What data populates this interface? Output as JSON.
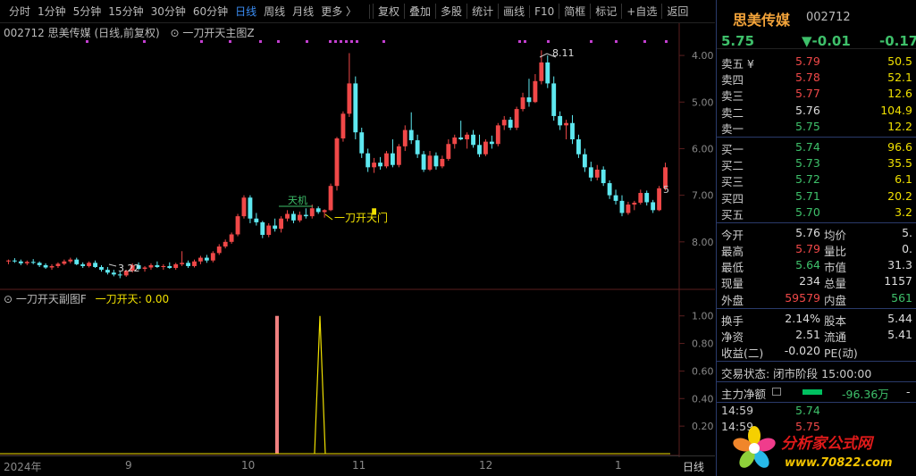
{
  "toolbar": {
    "periods": [
      "分时",
      "1分钟",
      "5分钟",
      "15分钟",
      "30分钟",
      "60分钟",
      "日线",
      "周线",
      "月线",
      "更多 〉"
    ],
    "active_period": "日线",
    "actions": [
      "复权",
      "叠加",
      "多股",
      "统计",
      "画线",
      "F10",
      "简框",
      "标记",
      "+自选",
      "返回"
    ]
  },
  "main_title": {
    "code": "002712",
    "name": "思美传媒",
    "mode": "(日线,前复权)",
    "indicator": "一刀开天主图Z"
  },
  "sub_title": {
    "name": "一刀开天副图F",
    "value_label": "一刀开天: 0.00"
  },
  "annotations": {
    "high": "8.11",
    "low": "3.22",
    "tianji": "天机",
    "signal": "一刀开天门",
    "last": "5"
  },
  "price_axis": [
    "8.00",
    "7.00",
    "6.00",
    "5.00",
    "4.00"
  ],
  "sub_axis": [
    "1.00",
    "0.80",
    "0.60",
    "0.40",
    "0.20"
  ],
  "date_axis": [
    "2024年",
    "9",
    "10",
    "11",
    "12",
    "1"
  ],
  "period_tag": "日线",
  "stock": {
    "name": "思美传媒",
    "code": "002712",
    "price": "5.75",
    "change": "▼-0.01",
    "pct": "-0.17"
  },
  "asks": [
    {
      "label": "卖五 ¥",
      "price": "5.79",
      "vol": "50.5"
    },
    {
      "label": "卖四",
      "price": "5.78",
      "vol": "52.1"
    },
    {
      "label": "卖三",
      "price": "5.77",
      "vol": "12.6"
    },
    {
      "label": "卖二",
      "price": "5.76",
      "vol": "104.9"
    },
    {
      "label": "卖一",
      "price": "5.75",
      "vol": "12.2"
    }
  ],
  "bids": [
    {
      "label": "买一",
      "price": "5.74",
      "vol": "96.6"
    },
    {
      "label": "买二",
      "price": "5.73",
      "vol": "35.5"
    },
    {
      "label": "买三",
      "price": "5.72",
      "vol": "6.1"
    },
    {
      "label": "买四",
      "price": "5.71",
      "vol": "20.2"
    },
    {
      "label": "买五",
      "price": "5.70",
      "vol": "3.2"
    }
  ],
  "stats": [
    {
      "l1": "今开",
      "v1": "5.76",
      "l2": "均价",
      "v2": "5."
    },
    {
      "l1": "最高",
      "v1": "5.79",
      "l2": "量比",
      "v2": "0."
    },
    {
      "l1": "最低",
      "v1": "5.64",
      "l2": "市值",
      "v2": "31.3"
    },
    {
      "l1": "现量",
      "v1": "234",
      "l2": "总量",
      "v2": "1157"
    },
    {
      "l1": "外盘",
      "v1": "59579",
      "l2": "内盘",
      "v2": "561"
    }
  ],
  "stats2": [
    {
      "l1": "换手",
      "v1": "2.14%",
      "l2": "股本",
      "v2": "5.44"
    },
    {
      "l1": "净资",
      "v1": "2.51",
      "l2": "流通",
      "v2": "5.41"
    },
    {
      "l1": "收益(二)",
      "v1": "-0.020",
      "l2": "PE(动)",
      "v2": ""
    }
  ],
  "trade_status": "交易状态: 闭市阶段 15:00:00",
  "main_flow": {
    "label": "主力净额",
    "value": "-96.36万",
    "tail": "-"
  },
  "ticks": [
    {
      "time": "14:59",
      "price": "5.74"
    },
    {
      "time": "14:59",
      "price": "5.75"
    }
  ],
  "logo_text": "分析家公式网",
  "logo_url": "www.70822.com",
  "colors": {
    "up": "#f04848",
    "down": "#5ee8f0",
    "signal": "#f0e000",
    "pink": "#f08080"
  },
  "chart_data": {
    "type": "candlestick",
    "ylim": [
      3.0,
      8.5
    ],
    "ticks": [
      4,
      5,
      6,
      7,
      8
    ],
    "high_label": 8.11,
    "low_label": 3.22,
    "candles": [
      [
        3.58,
        3.62,
        3.52,
        3.6
      ],
      [
        3.6,
        3.65,
        3.55,
        3.58
      ],
      [
        3.58,
        3.62,
        3.5,
        3.54
      ],
      [
        3.54,
        3.6,
        3.5,
        3.57
      ],
      [
        3.57,
        3.63,
        3.52,
        3.55
      ],
      [
        3.55,
        3.58,
        3.46,
        3.5
      ],
      [
        3.5,
        3.54,
        3.42,
        3.45
      ],
      [
        3.45,
        3.52,
        3.4,
        3.48
      ],
      [
        3.48,
        3.56,
        3.44,
        3.53
      ],
      [
        3.53,
        3.62,
        3.5,
        3.58
      ],
      [
        3.58,
        3.66,
        3.54,
        3.62
      ],
      [
        3.62,
        3.66,
        3.5,
        3.52
      ],
      [
        3.52,
        3.56,
        3.44,
        3.48
      ],
      [
        3.48,
        3.58,
        3.45,
        3.55
      ],
      [
        3.55,
        3.6,
        3.44,
        3.46
      ],
      [
        3.46,
        3.5,
        3.36,
        3.4
      ],
      [
        3.4,
        3.46,
        3.3,
        3.34
      ],
      [
        3.34,
        3.4,
        3.26,
        3.3
      ],
      [
        3.3,
        3.36,
        3.22,
        3.28
      ],
      [
        3.28,
        3.4,
        3.25,
        3.38
      ],
      [
        3.38,
        3.54,
        3.34,
        3.5
      ],
      [
        3.5,
        3.56,
        3.4,
        3.42
      ],
      [
        3.42,
        3.48,
        3.36,
        3.45
      ],
      [
        3.45,
        3.54,
        3.4,
        3.5
      ],
      [
        3.5,
        3.58,
        3.44,
        3.46
      ],
      [
        3.46,
        3.52,
        3.4,
        3.48
      ],
      [
        3.48,
        3.56,
        3.42,
        3.44
      ],
      [
        3.44,
        3.55,
        3.4,
        3.52
      ],
      [
        3.52,
        3.8,
        3.48,
        3.55
      ],
      [
        3.55,
        3.6,
        3.44,
        3.48
      ],
      [
        3.48,
        3.62,
        3.45,
        3.58
      ],
      [
        3.58,
        3.7,
        3.52,
        3.66
      ],
      [
        3.66,
        3.72,
        3.55,
        3.6
      ],
      [
        3.6,
        3.8,
        3.56,
        3.76
      ],
      [
        3.76,
        3.95,
        3.72,
        3.9
      ],
      [
        3.9,
        4.05,
        3.86,
        4.0
      ],
      [
        4.0,
        4.2,
        3.96,
        4.16
      ],
      [
        4.16,
        4.6,
        4.12,
        4.55
      ],
      [
        4.55,
        5.0,
        4.5,
        4.95
      ],
      [
        4.95,
        5.0,
        4.4,
        4.5
      ],
      [
        4.5,
        4.62,
        4.35,
        4.42
      ],
      [
        4.42,
        4.45,
        4.08,
        4.15
      ],
      [
        4.15,
        4.4,
        4.1,
        4.35
      ],
      [
        4.35,
        4.5,
        4.22,
        4.28
      ],
      [
        4.28,
        4.55,
        4.2,
        4.5
      ],
      [
        4.5,
        4.68,
        4.44,
        4.6
      ],
      [
        4.6,
        4.66,
        4.4,
        4.46
      ],
      [
        4.46,
        4.65,
        4.42,
        4.58
      ],
      [
        4.58,
        4.72,
        4.5,
        4.55
      ],
      [
        4.55,
        4.8,
        4.5,
        4.72
      ],
      [
        4.72,
        4.76,
        4.6,
        4.64
      ],
      [
        4.64,
        4.7,
        4.52,
        4.68
      ],
      [
        4.68,
        5.25,
        4.66,
        5.2
      ],
      [
        5.2,
        6.25,
        5.1,
        6.22
      ],
      [
        6.22,
        6.8,
        6.15,
        6.75
      ],
      [
        6.75,
        8.05,
        6.68,
        7.4
      ],
      [
        7.4,
        7.55,
        6.2,
        6.35
      ],
      [
        6.35,
        6.45,
        5.8,
        5.9
      ],
      [
        5.9,
        6.0,
        5.5,
        5.6
      ],
      [
        5.6,
        5.8,
        5.48,
        5.7
      ],
      [
        5.7,
        5.82,
        5.55,
        5.62
      ],
      [
        5.62,
        5.95,
        5.58,
        5.9
      ],
      [
        5.9,
        6.2,
        5.6,
        5.65
      ],
      [
        5.65,
        6.1,
        5.6,
        6.05
      ],
      [
        6.05,
        6.5,
        5.95,
        6.4
      ],
      [
        6.4,
        6.78,
        6.1,
        6.18
      ],
      [
        6.18,
        6.3,
        5.8,
        5.88
      ],
      [
        5.88,
        5.95,
        5.5,
        5.55
      ],
      [
        5.55,
        5.95,
        5.52,
        5.85
      ],
      [
        5.85,
        5.92,
        5.55,
        5.62
      ],
      [
        5.62,
        5.85,
        5.58,
        5.78
      ],
      [
        5.78,
        6.2,
        5.74,
        6.1
      ],
      [
        6.1,
        6.3,
        6.0,
        6.24
      ],
      [
        6.24,
        6.6,
        6.18,
        6.2
      ],
      [
        6.2,
        6.35,
        6.0,
        6.3
      ],
      [
        6.3,
        6.4,
        6.02,
        6.08
      ],
      [
        6.08,
        6.3,
        5.82,
        5.88
      ],
      [
        5.88,
        6.2,
        5.84,
        6.15
      ],
      [
        6.15,
        6.28,
        6.0,
        6.1
      ],
      [
        6.1,
        6.55,
        6.05,
        6.5
      ],
      [
        6.5,
        6.7,
        6.4,
        6.62
      ],
      [
        6.62,
        6.68,
        6.4,
        6.45
      ],
      [
        6.45,
        6.9,
        6.4,
        6.85
      ],
      [
        6.85,
        7.2,
        6.8,
        7.1
      ],
      [
        7.1,
        7.5,
        6.9,
        7.0
      ],
      [
        7.0,
        7.6,
        6.98,
        7.45
      ],
      [
        7.45,
        8.11,
        7.38,
        7.85
      ],
      [
        7.85,
        8.0,
        7.3,
        7.4
      ],
      [
        7.4,
        7.55,
        6.6,
        6.7
      ],
      [
        6.7,
        6.8,
        6.4,
        6.5
      ],
      [
        6.5,
        6.62,
        6.2,
        6.55
      ],
      [
        6.55,
        6.72,
        6.1,
        6.2
      ],
      [
        6.2,
        6.3,
        5.8,
        5.88
      ],
      [
        5.88,
        6.0,
        5.5,
        5.6
      ],
      [
        5.6,
        5.72,
        5.3,
        5.38
      ],
      [
        5.38,
        5.65,
        5.32,
        5.55
      ],
      [
        5.55,
        5.62,
        5.2,
        5.26
      ],
      [
        5.26,
        5.32,
        4.92,
        5.0
      ],
      [
        5.0,
        5.12,
        4.8,
        4.88
      ],
      [
        4.88,
        5.0,
        4.55,
        4.62
      ],
      [
        4.62,
        4.86,
        4.58,
        4.8
      ],
      [
        4.8,
        4.88,
        4.68,
        4.84
      ],
      [
        4.84,
        5.12,
        4.8,
        5.05
      ],
      [
        5.05,
        5.1,
        4.78,
        4.85
      ],
      [
        4.85,
        4.9,
        4.62,
        4.68
      ],
      [
        4.68,
        5.2,
        4.66,
        5.15
      ],
      [
        5.15,
        5.7,
        5.1,
        5.6
      ]
    ],
    "sub_series": {
      "name": "一刀开天",
      "ylim": [
        0,
        1.05
      ],
      "spikes": [
        {
          "x_date": "10",
          "index": 52,
          "value": 1.0,
          "color": "#f08080",
          "type": "bar"
        },
        {
          "index": 59,
          "value": 1.0,
          "color": "#f0e000",
          "type": "peak"
        }
      ]
    }
  }
}
